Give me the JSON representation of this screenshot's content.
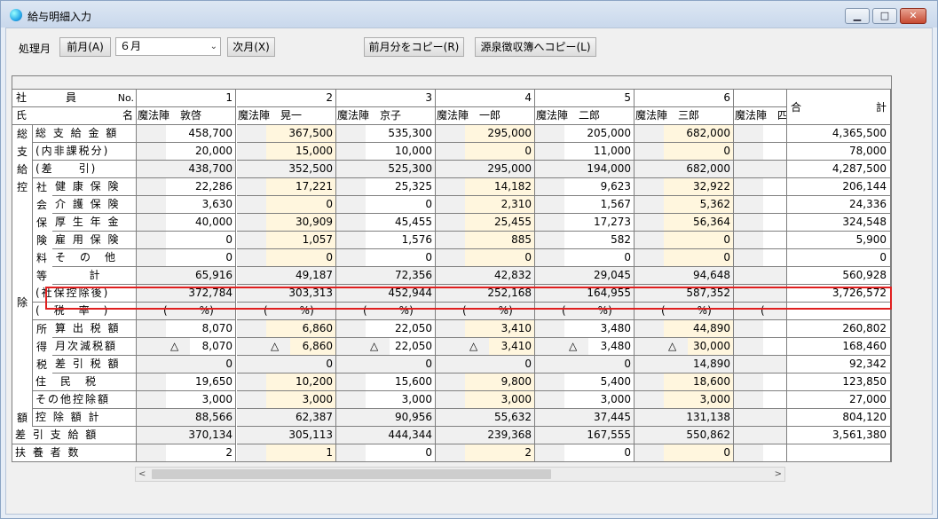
{
  "window": {
    "title": "給与明細入力",
    "min": "▁",
    "max": "□",
    "close": "✕"
  },
  "toolbar": {
    "period_label": "処理月",
    "prev_month": "前月(A)",
    "month_value": "６月",
    "next_month": "次月(X)",
    "copy_prev": "前月分をコピー(R)",
    "copy_ledger": "源泉徴収簿へコピー(L)"
  },
  "grid": {
    "header_labels": {
      "employee": "社　　　員",
      "no": "No.",
      "name_left": "氏",
      "name_right": "名",
      "total_left": "合",
      "total_right": "計"
    },
    "employees": [
      {
        "no": "1",
        "name": "魔法陣　敦啓"
      },
      {
        "no": "2",
        "name": "魔法陣　晃一"
      },
      {
        "no": "3",
        "name": "魔法陣　京子"
      },
      {
        "no": "4",
        "name": "魔法陣　一郎"
      },
      {
        "no": "5",
        "name": "魔法陣　二郎"
      },
      {
        "no": "6",
        "name": "魔法陣　三郎"
      },
      {
        "no": "",
        "name": "魔法陣　四"
      }
    ],
    "side_groups": {
      "so": "総",
      "shi": "支",
      "kyu": "給",
      "kou": "控",
      "jo": "除",
      "gaku": "額",
      "sha": "社",
      "kai": "会",
      "ho": "保",
      "ken": "険",
      "ryo": "料",
      "tou": "等",
      "sho": "所",
      "toku": "得",
      "zei": "税"
    },
    "rows": [
      {
        "label": "総 支 給 金 額",
        "values": [
          "458,700",
          "367,500",
          "535,300",
          "295,000",
          "205,000",
          "682,000",
          ""
        ],
        "total": "4,365,500"
      },
      {
        "label": "(内非課税分)",
        "values": [
          "20,000",
          "15,000",
          "10,000",
          "0",
          "11,000",
          "0",
          ""
        ],
        "total": "78,000"
      },
      {
        "label": "(差　　引)",
        "values": [
          "438,700",
          "352,500",
          "525,300",
          "295,000",
          "194,000",
          "682,000",
          ""
        ],
        "total": "4,287,500"
      },
      {
        "label": "健 康 保 険",
        "values": [
          "22,286",
          "17,221",
          "25,325",
          "14,182",
          "9,623",
          "32,922",
          ""
        ],
        "total": "206,144"
      },
      {
        "label": "介 護 保 険",
        "values": [
          "3,630",
          "0",
          "0",
          "2,310",
          "1,567",
          "5,362",
          ""
        ],
        "total": "24,336"
      },
      {
        "label": "厚 生 年 金",
        "values": [
          "40,000",
          "30,909",
          "45,455",
          "25,455",
          "17,273",
          "56,364",
          ""
        ],
        "total": "324,548"
      },
      {
        "label": "雇 用 保 険",
        "values": [
          "0",
          "1,057",
          "1,576",
          "885",
          "582",
          "0",
          ""
        ],
        "total": "5,900"
      },
      {
        "label": "そ　の　他",
        "values": [
          "0",
          "0",
          "0",
          "0",
          "0",
          "0",
          ""
        ],
        "total": "0"
      },
      {
        "label": "計",
        "values": [
          "65,916",
          "49,187",
          "72,356",
          "42,832",
          "29,045",
          "94,648",
          ""
        ],
        "total": "560,928"
      },
      {
        "label": "(社保控除後)",
        "values": [
          "372,784",
          "303,313",
          "452,944",
          "252,168",
          "164,955",
          "587,352",
          ""
        ],
        "total": "3,726,572"
      },
      {
        "label": "(　税　率　)",
        "values": [
          "(　　　%)",
          "(　　　%)",
          "(　　　%)",
          "(　　　%)",
          "(　　　%)",
          "(　　　%)",
          "("
        ],
        "total": ""
      },
      {
        "label": "算 出 税 額",
        "values": [
          "8,070",
          "6,860",
          "22,050",
          "3,410",
          "3,480",
          "44,890",
          ""
        ],
        "total": "260,802"
      },
      {
        "label": "月次減税額",
        "values": [
          "8,070",
          "6,860",
          "22,050",
          "3,410",
          "3,480",
          "30,000",
          ""
        ],
        "total": "168,460",
        "prefix": "△"
      },
      {
        "label": "差 引 税 額",
        "values": [
          "0",
          "0",
          "0",
          "0",
          "0",
          "14,890",
          ""
        ],
        "total": "92,342"
      },
      {
        "label": "住　民　税",
        "values": [
          "19,650",
          "10,200",
          "15,600",
          "9,800",
          "5,400",
          "18,600",
          ""
        ],
        "total": "123,850"
      },
      {
        "label": "その他控除額",
        "values": [
          "3,000",
          "3,000",
          "3,000",
          "3,000",
          "3,000",
          "3,000",
          ""
        ],
        "total": "27,000"
      },
      {
        "label": "控 除 額 計",
        "values": [
          "88,566",
          "62,387",
          "90,956",
          "55,632",
          "37,445",
          "131,138",
          ""
        ],
        "total": "804,120"
      },
      {
        "label": "差 引 支 給 額",
        "values": [
          "370,134",
          "305,113",
          "444,344",
          "239,368",
          "167,555",
          "550,862",
          ""
        ],
        "total": "3,561,380"
      },
      {
        "label": "扶 養 者 数",
        "values": [
          "2",
          "1",
          "0",
          "2",
          "0",
          "0",
          ""
        ],
        "total": ""
      }
    ]
  },
  "scroll": {
    "left": "<",
    "right": ">"
  }
}
